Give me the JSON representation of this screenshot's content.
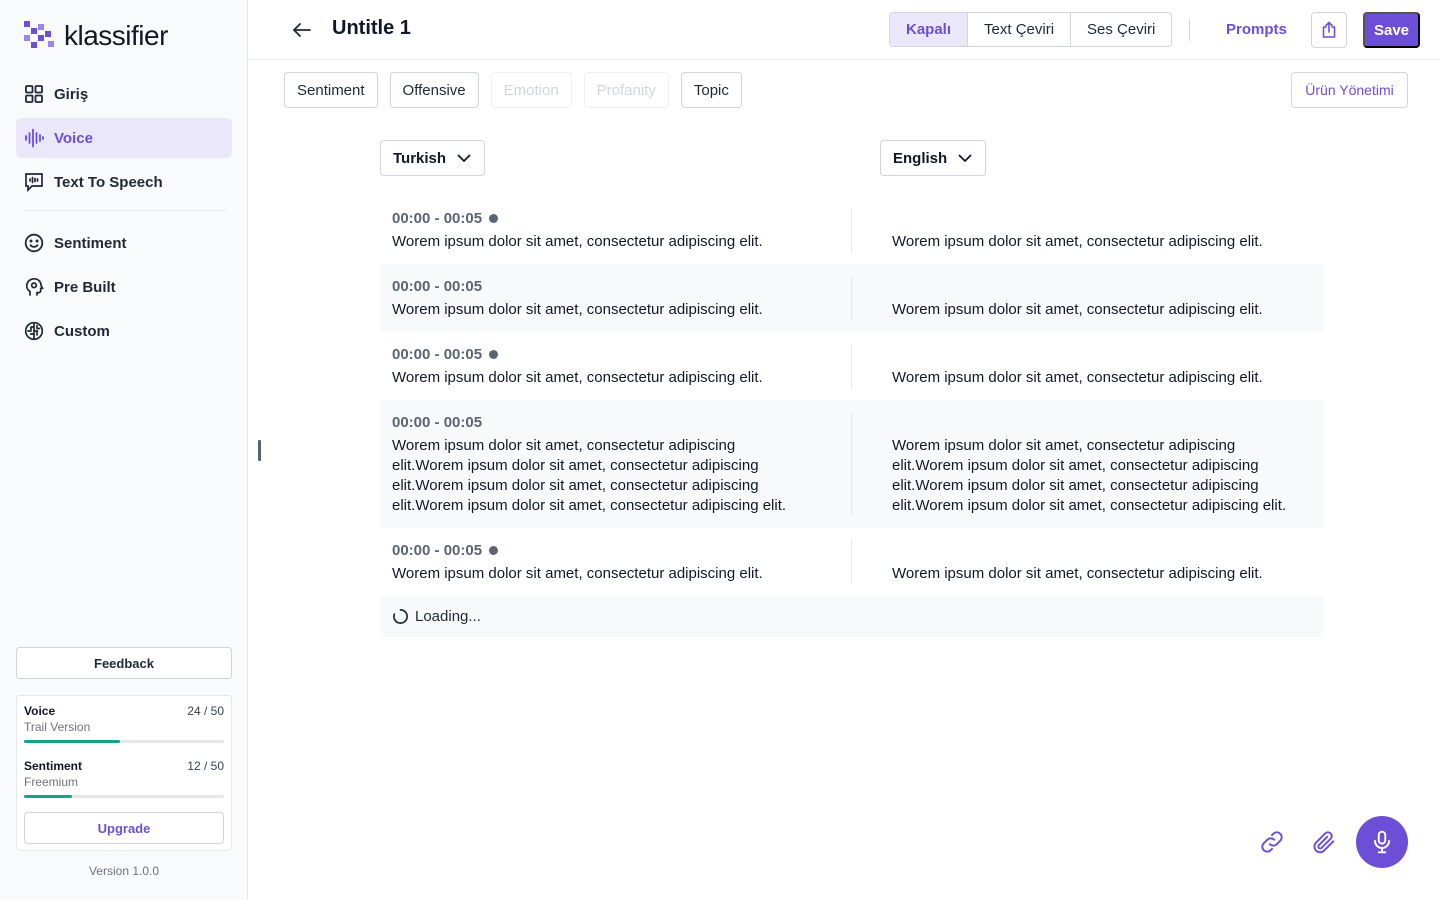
{
  "brand": {
    "name": "klassifier",
    "accent": "#6c4fd6"
  },
  "sidebar": {
    "items": [
      {
        "label": "Giriş",
        "icon": "grid-icon"
      },
      {
        "label": "Voice",
        "icon": "waveform-icon",
        "active": true
      },
      {
        "label": "Text To Speech",
        "icon": "speech-bubble-icon"
      },
      {
        "label": "Sentiment",
        "icon": "smiley-icon"
      },
      {
        "label": "Pre Built",
        "icon": "head-icon"
      },
      {
        "label": "Custom",
        "icon": "brain-icon"
      }
    ],
    "feedback_label": "Feedback",
    "usage": [
      {
        "name": "Voice",
        "plan": "Trail Version",
        "count": "24 / 50",
        "fraction": 0.48
      },
      {
        "name": "Sentiment",
        "plan": "Freemium",
        "count": "12 / 50",
        "fraction": 0.24
      }
    ],
    "upgrade_label": "Upgrade",
    "version": "Version 1.0.0"
  },
  "header": {
    "title": "Untitle 1",
    "segments": [
      {
        "label": "Kapalı",
        "active": true
      },
      {
        "label": "Text Çeviri"
      },
      {
        "label": "Ses Çeviri"
      }
    ],
    "prompts_label": "Prompts",
    "save_label": "Save"
  },
  "chips": [
    {
      "label": "Sentiment",
      "enabled": true
    },
    {
      "label": "Offensive",
      "enabled": true
    },
    {
      "label": "Emotion",
      "enabled": false
    },
    {
      "label": "Profanity",
      "enabled": false
    },
    {
      "label": "Topic",
      "enabled": true
    }
  ],
  "urun_label": "Ürün Yönetimi",
  "languages": {
    "source": "Turkish",
    "target": "English"
  },
  "transcript": [
    {
      "time": "00:00 - 00:05",
      "dot": true,
      "source": "Worem ipsum dolor sit amet, consectetur adipiscing elit.",
      "target": "Worem ipsum dolor sit amet, consectetur adipiscing elit."
    },
    {
      "time": "00:00 - 00:05",
      "dot": false,
      "source": "Worem ipsum dolor sit amet, consectetur adipiscing elit.",
      "target": "Worem ipsum dolor sit amet, consectetur adipiscing elit."
    },
    {
      "time": "00:00 - 00:05",
      "dot": true,
      "source": "Worem ipsum dolor sit amet, consectetur adipiscing elit.",
      "target": "Worem ipsum dolor sit amet, consectetur adipiscing elit."
    },
    {
      "time": "00:00 - 00:05",
      "dot": false,
      "source": "Worem ipsum dolor sit amet, consectetur adipiscing elit.Worem ipsum dolor sit amet, consectetur adipiscing elit.Worem ipsum dolor sit amet, consectetur adipiscing elit.Worem ipsum dolor sit amet, consectetur adipiscing elit.",
      "target": "Worem ipsum dolor sit amet, consectetur adipiscing elit.Worem ipsum dolor sit amet, consectetur adipiscing elit.Worem ipsum dolor sit amet, consectetur adipiscing elit.Worem ipsum dolor sit amet, consectetur adipiscing elit."
    },
    {
      "time": "00:00 - 00:05",
      "dot": true,
      "source": "Worem ipsum dolor sit amet, consectetur adipiscing elit.",
      "target": "Worem ipsum dolor sit amet, consectetur adipiscing elit."
    }
  ],
  "loading_label": "Loading..."
}
